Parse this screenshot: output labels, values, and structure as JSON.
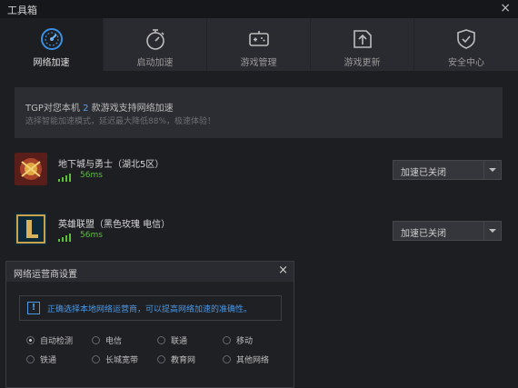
{
  "window": {
    "title": "工具箱",
    "close_symbol": "×"
  },
  "tabs": [
    {
      "label": "网络加速",
      "icon": "speedometer-icon",
      "active": true
    },
    {
      "label": "启动加速",
      "icon": "stopwatch-icon",
      "active": false
    },
    {
      "label": "游戏管理",
      "icon": "gamepad-icon",
      "active": false
    },
    {
      "label": "游戏更新",
      "icon": "update-arrow-icon",
      "active": false
    },
    {
      "label": "安全中心",
      "icon": "shield-check-icon",
      "active": false
    }
  ],
  "info": {
    "prefix": "TGP对您本机 ",
    "count": "2",
    "suffix": " 款游戏支持网络加速",
    "subtitle": "选择智能加速模式，延迟最大降低88%，极速体验！"
  },
  "games": [
    {
      "name": "地下城与勇士（湖北5区）",
      "ping": "56ms",
      "status": "加速已关闭",
      "icon": "dnf-game-icon"
    },
    {
      "name": "英雄联盟（黑色玫瑰 电信）",
      "ping": "56ms",
      "status": "加速已关闭",
      "icon": "lol-game-icon"
    }
  ],
  "dialog": {
    "title": "网络运营商设置",
    "close_symbol": "×",
    "notice_icon": "!",
    "notice": "正确选择本地网络运营商，可以提高网络加速的准确性。",
    "options": [
      {
        "label": "自动检测",
        "checked": true
      },
      {
        "label": "电信",
        "checked": false
      },
      {
        "label": "联通",
        "checked": false
      },
      {
        "label": "移动",
        "checked": false
      },
      {
        "label": "铁通",
        "checked": false
      },
      {
        "label": "长城宽带",
        "checked": false
      },
      {
        "label": "教育网",
        "checked": false
      },
      {
        "label": "其他网络",
        "checked": false
      }
    ]
  },
  "colors": {
    "accent": "#4a98e6",
    "ping": "#5bbf3a",
    "background": "#1d1e22"
  }
}
